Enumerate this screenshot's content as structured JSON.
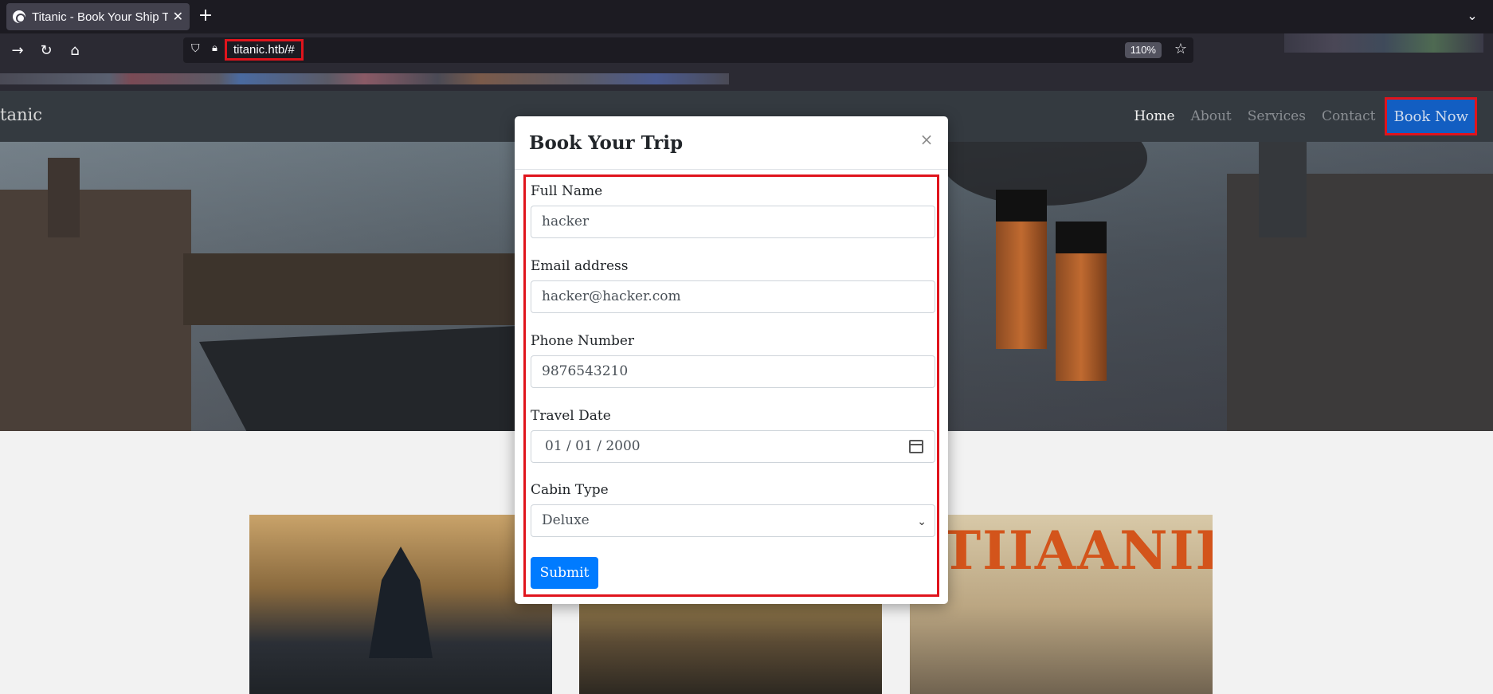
{
  "browser": {
    "tab_title": "Titanic - Book Your Ship T",
    "new_tab": "+",
    "url": "titanic.htb/#",
    "zoom": "110%"
  },
  "site": {
    "brand": "tanic",
    "nav": {
      "home": "Home",
      "about": "About",
      "services": "Services",
      "contact": "Contact",
      "book_now": "Book Now"
    }
  },
  "poster": {
    "title": "TIIAANIIC"
  },
  "modal": {
    "title": "Book Your Trip",
    "close": "×",
    "fields": {
      "name_label": "Full Name",
      "name_value": "hacker",
      "email_label": "Email address",
      "email_value": "hacker@hacker.com",
      "phone_label": "Phone Number",
      "phone_value": "9876543210",
      "date_label": "Travel Date",
      "date_value": "01 / 01 / 2000",
      "cabin_label": "Cabin Type",
      "cabin_value": "Deluxe"
    },
    "submit": "Submit"
  },
  "colors": {
    "highlight": "#e0141c",
    "primary": "#007bff"
  }
}
